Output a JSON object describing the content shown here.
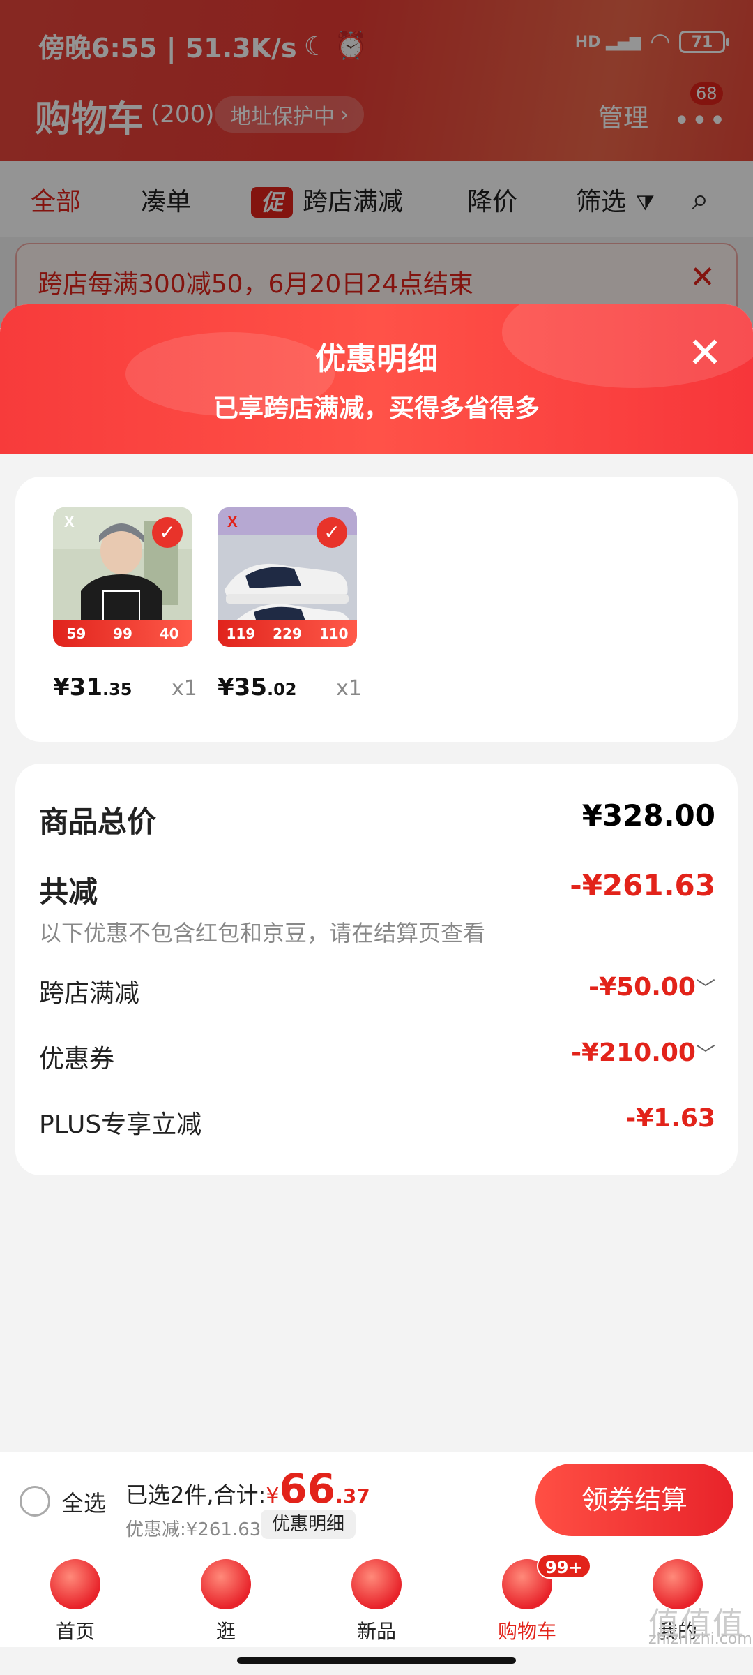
{
  "status_bar": {
    "time": "傍晚6:55 | 51.3K/s",
    "moon": "☾",
    "alarm": "⏰",
    "signal": "HD ▂▄▆",
    "wifi": "◠",
    "battery": "71"
  },
  "header": {
    "title": "购物车",
    "count": "(200)",
    "address_pill": "地址保护中",
    "address_arrow": "›",
    "manage": "管理",
    "more_dots": "•••",
    "more_badge": "68"
  },
  "tabs": {
    "all": "全部",
    "bundle": "凑单",
    "promo_tag": "促",
    "cross_store": "跨店满减",
    "price_drop": "降价",
    "filter": "筛选",
    "filter_icon": "⧩",
    "search_icon": "⌕"
  },
  "promo_banner": {
    "text": "跨店每满300减50，6月20日24点结束",
    "close": "✕"
  },
  "sheet": {
    "title": "优惠明细",
    "subtitle": "已享跨店满减，买得多省得多",
    "close": "✕"
  },
  "products": [
    {
      "price_main": "¥31",
      "price_dec": ".35",
      "qty": "x1",
      "strip": [
        "59",
        "99",
        "40"
      ],
      "check": "✓"
    },
    {
      "price_main": "¥35",
      "price_dec": ".02",
      "qty": "x1",
      "strip": [
        "119",
        "229",
        "110"
      ],
      "check": "✓"
    }
  ],
  "summary": {
    "total_label": "商品总价",
    "total_value": "¥328.00",
    "reduce_label": "共减",
    "reduce_value": "-¥261.63",
    "note": "以下优惠不包含红包和京豆，请在结算页查看",
    "rows": [
      {
        "label": "跨店满减",
        "value": "-¥50.00",
        "chev": "﹀"
      },
      {
        "label": "优惠券",
        "value": "-¥210.00",
        "chev": "﹀"
      },
      {
        "label": "PLUS专享立减",
        "value": "-¥1.63"
      }
    ]
  },
  "checkout": {
    "select_all": "全选",
    "selected_prefix": "已选2件,合计:",
    "currency": "¥",
    "amount_int": "66",
    "amount_dec": ".37",
    "discount": "优惠减:¥261.63",
    "detail_pill": "优惠明细",
    "pay_button": "领券结算"
  },
  "tabbar": [
    {
      "label": "首页"
    },
    {
      "label": "逛"
    },
    {
      "label": "新品"
    },
    {
      "label": "购物车",
      "badge": "99+"
    },
    {
      "label": "我的"
    }
  ],
  "watermark": {
    "glyphs": "值值值",
    "text": "zhizhizhi.com"
  },
  "colors": {
    "accent": "#e2231a",
    "header": "#ea3b34",
    "sheet_header": "#ff5248"
  }
}
